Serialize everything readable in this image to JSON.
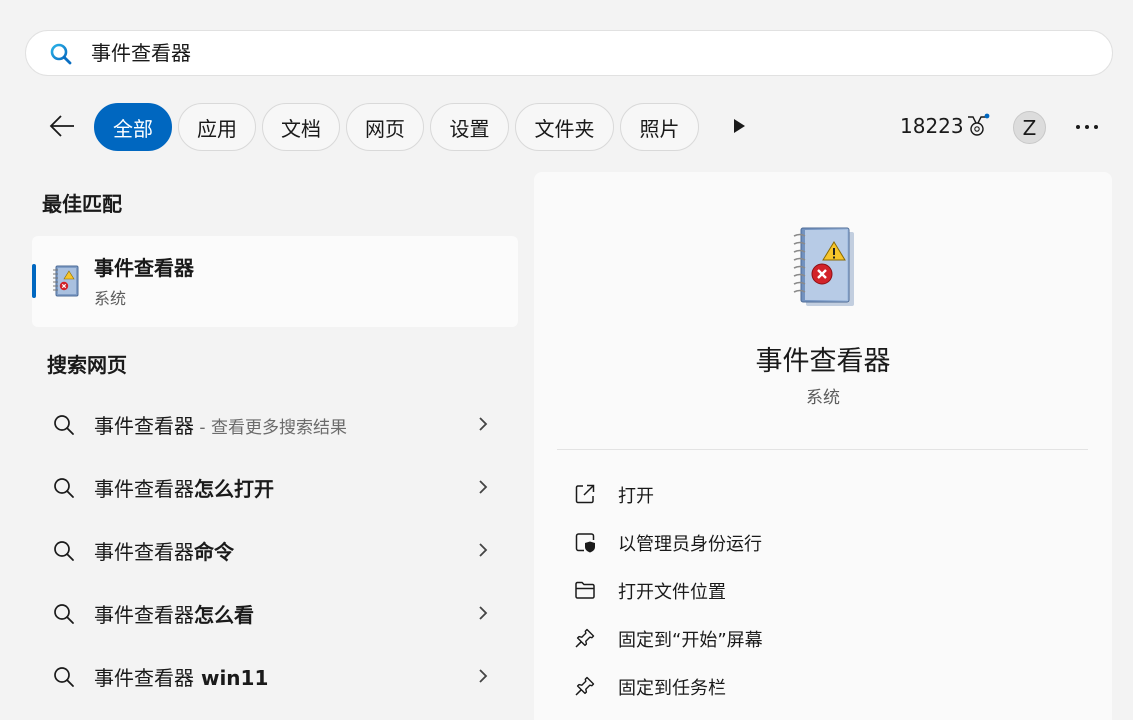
{
  "search": {
    "query": "事件查看器"
  },
  "filters": {
    "chips": [
      {
        "label": "全部",
        "active": true
      },
      {
        "label": "应用",
        "active": false
      },
      {
        "label": "文档",
        "active": false
      },
      {
        "label": "网页",
        "active": false
      },
      {
        "label": "设置",
        "active": false
      },
      {
        "label": "文件夹",
        "active": false
      },
      {
        "label": "照片",
        "active": false
      }
    ],
    "points": "18223",
    "avatar_initial": "Z"
  },
  "best_match": {
    "section_title": "最佳匹配",
    "name": "事件查看器",
    "type": "系统"
  },
  "web_search": {
    "section_title": "搜索网页",
    "items": [
      {
        "prefix": "事件查看器",
        "bold": "",
        "hint": " - 查看更多搜索结果"
      },
      {
        "prefix": "事件查看器",
        "bold": "怎么打开",
        "hint": ""
      },
      {
        "prefix": "事件查看器",
        "bold": "命令",
        "hint": ""
      },
      {
        "prefix": "事件查看器",
        "bold": "怎么看",
        "hint": ""
      },
      {
        "prefix": "事件查看器",
        "bold": " win11",
        "hint": ""
      }
    ]
  },
  "detail": {
    "name": "事件查看器",
    "type": "系统",
    "actions": [
      {
        "label": "打开",
        "icon": "open-external-icon"
      },
      {
        "label": "以管理员身份运行",
        "icon": "run-as-admin-icon"
      },
      {
        "label": "打开文件位置",
        "icon": "folder-icon"
      },
      {
        "label": "固定到“开始”屏幕",
        "icon": "pin-icon"
      },
      {
        "label": "固定到任务栏",
        "icon": "pin-icon"
      }
    ]
  },
  "colors": {
    "accent": "#0067c0",
    "background": "#f3f3f3"
  }
}
